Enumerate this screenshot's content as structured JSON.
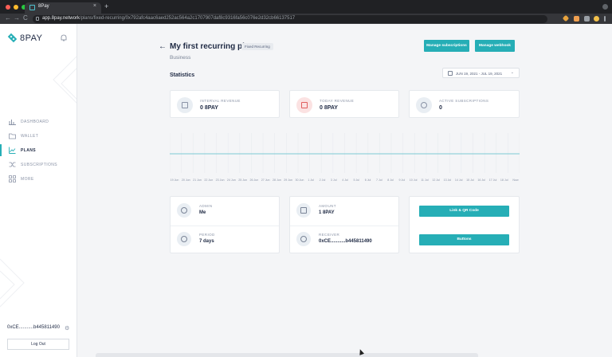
{
  "browser": {
    "tab_title": "8Pay",
    "tab_close": "×",
    "new_tab": "+",
    "url_domain": "app.8pay.network",
    "url_path": "/plans/fixed-recurring/0x792afc4aac6aed252ac564a2c1707907daf8c9316fa56c076e2d32cb66137517",
    "nav_back": "←",
    "nav_forward": "→",
    "nav_reload": "C"
  },
  "sidebar": {
    "logo_text": "8PAY",
    "items": [
      {
        "label": "DASHBOARD",
        "icon": "bar-chart-icon"
      },
      {
        "label": "WALLET",
        "icon": "folder-icon"
      },
      {
        "label": "PLANS",
        "icon": "trend-icon"
      },
      {
        "label": "SUBSCRIPTIONS",
        "icon": "shuffle-icon"
      },
      {
        "label": "MORE",
        "icon": "grid-icon"
      }
    ],
    "active_item": "PLANS",
    "wallet_address": "0xCE...........b445811490",
    "logout_label": "Log Out"
  },
  "header": {
    "back_symbol": "←",
    "title": "My first recurring plan",
    "badge": "Fixed Recurring",
    "subtitle": "Business",
    "manage_subscriptions": "Manage subscriptions",
    "manage_webhook": "Manage webhook"
  },
  "statistics": {
    "title": "Statistics",
    "date_range": "JUN 19, 2021 - JUL 19, 2021",
    "cards": [
      {
        "label": "INTERVAL REVENUE",
        "value": "0 8PAY",
        "icon": "coins-icon"
      },
      {
        "label": "TODAY REVENUE",
        "value": "0 8PAY",
        "icon": "wallet-icon"
      },
      {
        "label": "ACTIVE SUBSCRIPTIONS",
        "value": "0",
        "icon": "user-icon"
      }
    ]
  },
  "chart_data": {
    "type": "line",
    "categories": [
      "19 Jun",
      "20 Jun",
      "21 Jun",
      "22 Jun",
      "23 Jun",
      "24 Jun",
      "25 Jun",
      "26 Jun",
      "27 Jun",
      "28 Jun",
      "29 Jun",
      "30 Jun",
      "1 Jul",
      "2 Jul",
      "3 Jul",
      "4 Jul",
      "5 Jul",
      "6 Jul",
      "7 Jul",
      "8 Jul",
      "9 Jul",
      "10 Jul",
      "11 Jul",
      "12 Jul",
      "13 Jul",
      "14 Jul",
      "15 Jul",
      "16 Jul",
      "17 Jul",
      "18 Jul",
      "Now"
    ],
    "values": [
      0,
      0,
      0,
      0,
      0,
      0,
      0,
      0,
      0,
      0,
      0,
      0,
      0,
      0,
      0,
      0,
      0,
      0,
      0,
      0,
      0,
      0,
      0,
      0,
      0,
      0,
      0,
      0,
      0,
      0,
      0
    ],
    "line_color": "#7cc9d3",
    "grid": true
  },
  "details": {
    "admin_label": "ADMIN",
    "admin_value": "Me",
    "period_label": "PERIOD",
    "period_value": "7 days",
    "amount_label": "AMOUNT",
    "amount_value": "1 8PAY",
    "receiver_label": "RECEIVER",
    "receiver_value": "0xCE...........b445811490",
    "link_button": "Link & QR Code",
    "buttons_button": "Buttons"
  },
  "colors": {
    "accent": "#26aeb6",
    "text": "#1f2a44",
    "muted": "#8a93a6",
    "background": "#f4f5f7"
  }
}
